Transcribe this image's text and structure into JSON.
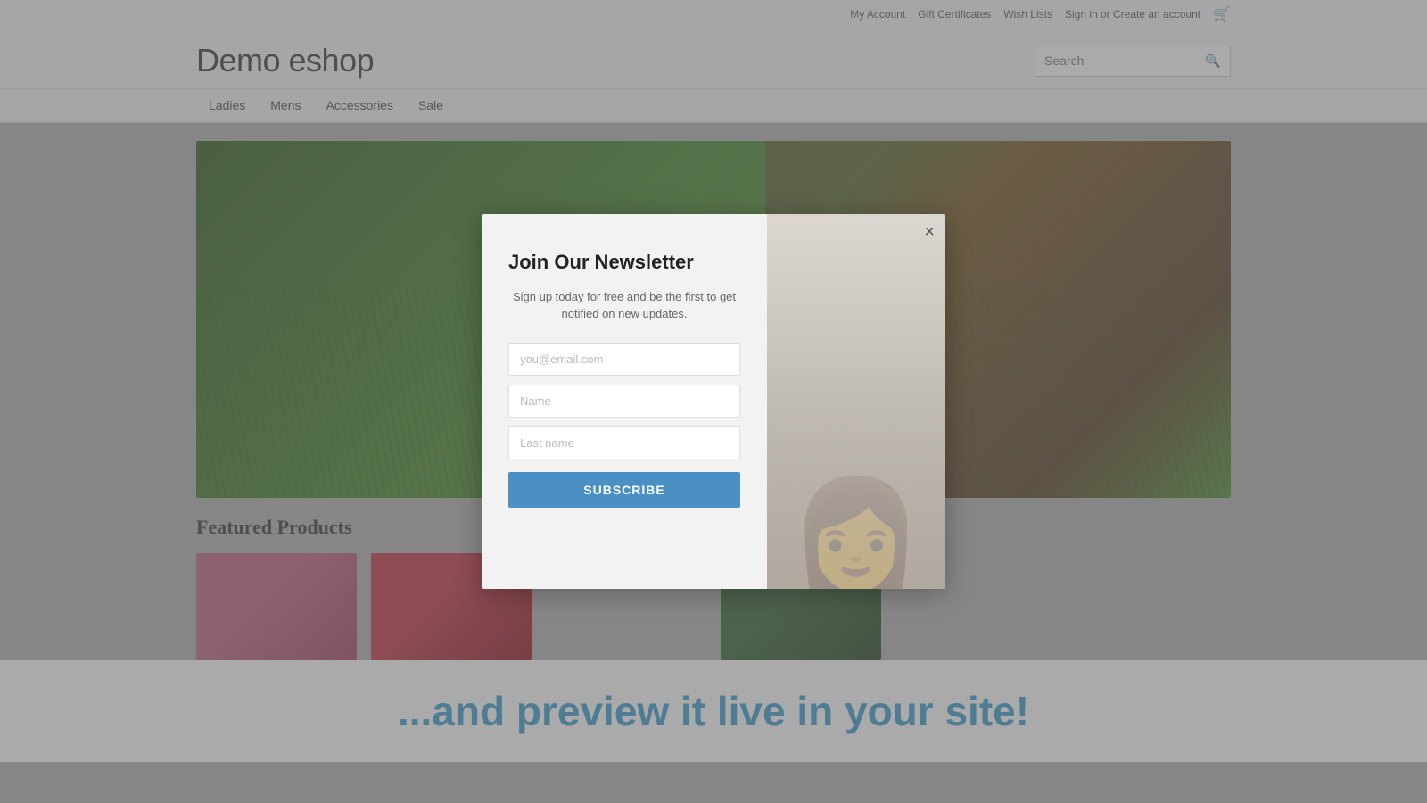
{
  "topbar": {
    "my_account": "My Account",
    "gift_certificates": "Gift Certificates",
    "wish_lists": "Wish Lists",
    "sign_in": "Sign in or Create an account"
  },
  "header": {
    "logo": "Demo eshop",
    "search_placeholder": "Search"
  },
  "nav": {
    "items": [
      {
        "label": "Ladies"
      },
      {
        "label": "Mens"
      },
      {
        "label": "Accessories"
      },
      {
        "label": "Sale"
      }
    ]
  },
  "featured": {
    "title": "Featured Products"
  },
  "modal": {
    "title": "Join Our Newsletter",
    "description": "Sign up today for free and be the first to get notified on new updates.",
    "email_placeholder": "you@email.com",
    "name_placeholder": "Name",
    "last_name_placeholder": "Last name",
    "subscribe_label": "Subscribe",
    "close_label": "×"
  },
  "promo": {
    "text": "...and preview it live in your site!"
  }
}
